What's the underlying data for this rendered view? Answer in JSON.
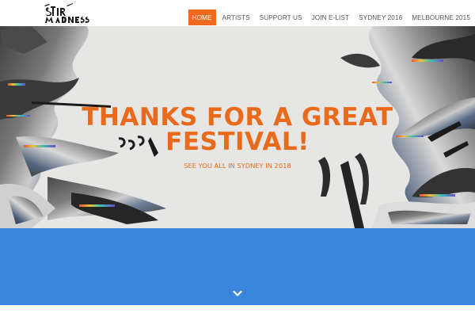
{
  "brand": {
    "logo_name": "stir-madness-logo",
    "accent": "#ee6a1f",
    "band_color": "#3a86dc"
  },
  "nav": {
    "items": [
      {
        "label": "HOME",
        "active": true
      },
      {
        "label": "ARTISTS"
      },
      {
        "label": "SUPPORT US"
      },
      {
        "label": "JOIN E-LIST"
      },
      {
        "label": "SYDNEY 2016"
      },
      {
        "label": "MELBOURNE 2015"
      }
    ]
  },
  "hero": {
    "title_line1": "THANKS FOR A GREAT",
    "title_line2": "FESTIVAL!",
    "subtitle": "SEE YOU ALL IN SYDNEY IN 2018"
  },
  "band": {
    "scroll_icon": "chevron-down-icon"
  }
}
